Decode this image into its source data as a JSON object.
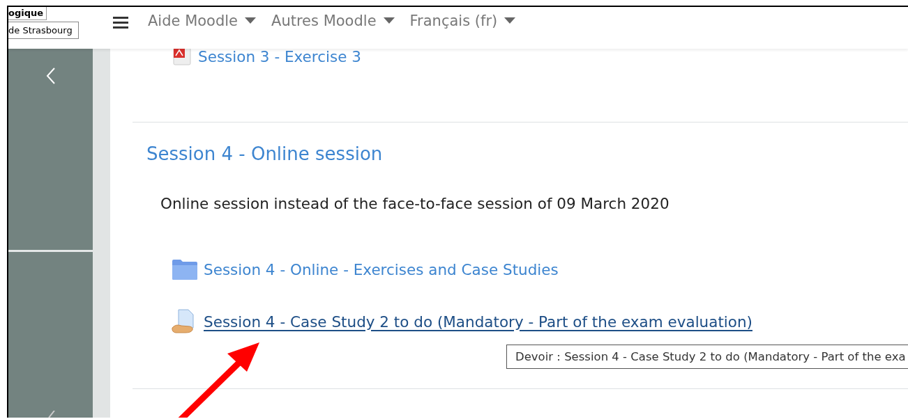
{
  "top_left": {
    "lines": [
      "ogique",
      "de Strasbourg"
    ]
  },
  "navbar": {
    "menu_items": [
      {
        "label": "Aide Moodle"
      },
      {
        "label": "Autres Moodle"
      },
      {
        "label": "Français (fr)"
      }
    ]
  },
  "previous_activity": {
    "kind": "pdf",
    "label": "Session 3 - Exercise 3",
    "hovered": false
  },
  "section": {
    "title": "Session 4 - Online session",
    "summary": "Online session instead of the face-to-face session of 09 March 2020",
    "activities": [
      {
        "kind": "folder",
        "label": "Session 4 - Online - Exercises and Case Studies",
        "hovered": false
      },
      {
        "kind": "assignment",
        "label": "Session 4 - Case Study 2 to do (Mandatory - Part of the exam evaluation)",
        "hovered": true
      }
    ]
  },
  "tooltip": {
    "text": "Devoir : Session 4 - Case Study 2 to do (Mandatory - Part of the exa"
  }
}
